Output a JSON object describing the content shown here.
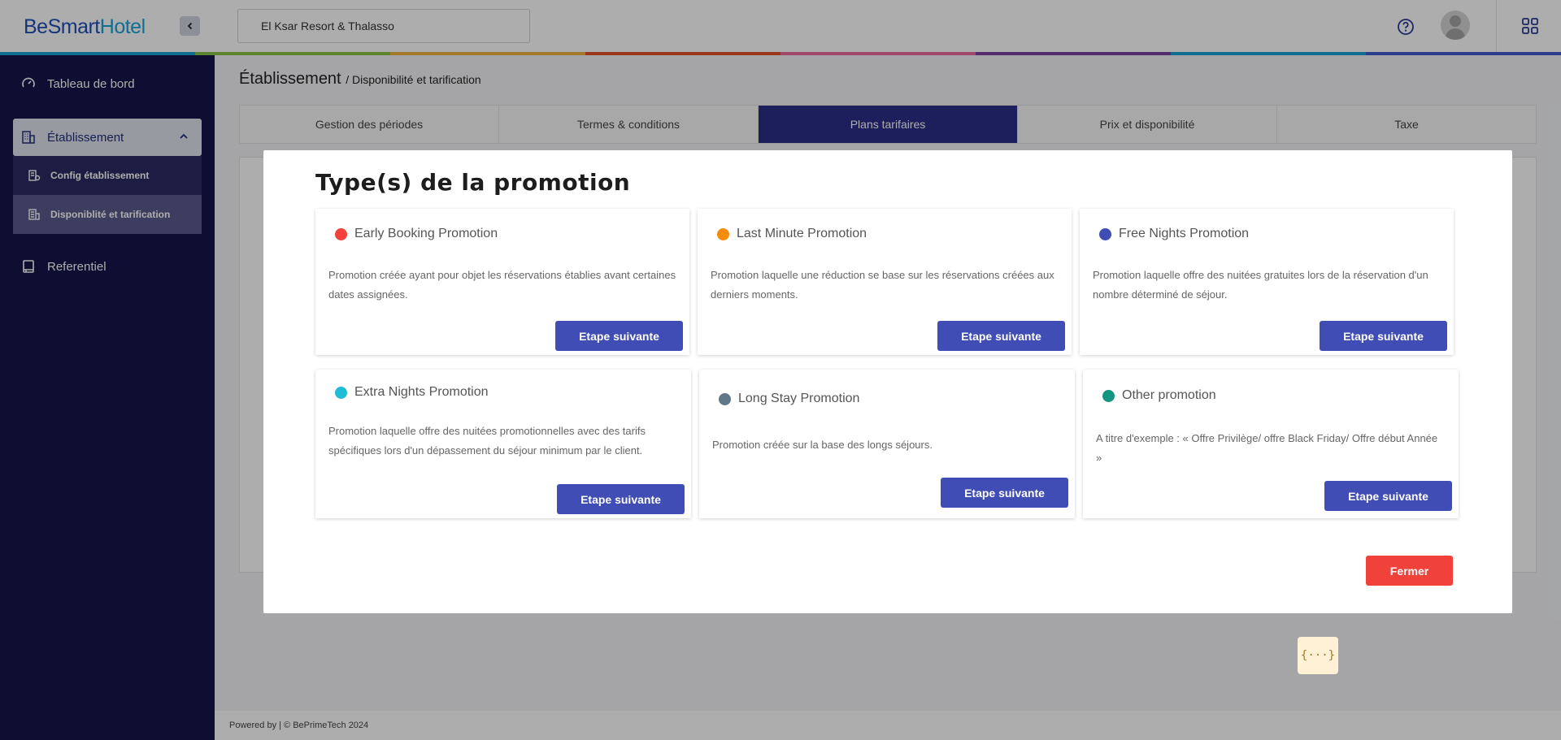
{
  "app": {
    "logo_part1": "BeSmart",
    "logo_part2": "Hotel"
  },
  "header": {
    "hotel_select_value": "El Ksar Resort & Thalasso",
    "rainbow_colors": [
      "#1aa3d6",
      "#8bc34a",
      "#f2b33d",
      "#e2502a",
      "#ec6a9c",
      "#7b3fa0",
      "#1aa3d6",
      "#3f5bd0"
    ]
  },
  "sidebar": {
    "items": [
      {
        "label": "Tableau de bord",
        "icon": "dashboard-icon"
      },
      {
        "label": "Établissement",
        "icon": "building-icon",
        "expanded": true
      },
      {
        "label": "Referentiel",
        "icon": "book-icon"
      }
    ],
    "subitems": [
      {
        "label": "Config établissement",
        "icon": "config-icon"
      },
      {
        "label": "Disponiblité et tarification",
        "icon": "pricing-icon",
        "selected": true
      }
    ]
  },
  "page": {
    "title": "Établissement",
    "breadcrumb": "/ Disponibilité et tarification",
    "tabs": [
      "Gestion des périodes",
      "Termes & conditions",
      "Plans tarifaires",
      "Prix et disponibilité",
      "Taxe"
    ],
    "active_tab": "Plans tarifaires"
  },
  "modal": {
    "title": "Type(s) de la promotion",
    "next_label": "Etape suivante",
    "close_label": "Fermer",
    "cards": [
      {
        "title": "Early Booking Promotion",
        "color": "#f0413a",
        "desc": "Promotion créée ayant pour objet les réservations établies avant certaines dates assignées."
      },
      {
        "title": "Last Minute Promotion",
        "color": "#f58c0c",
        "desc": "Promotion laquelle une réduction se base sur les réservations créées aux derniers moments."
      },
      {
        "title": "Free Nights Promotion",
        "color": "#3f4db4",
        "desc": "Promotion laquelle offre des nuitées gratuites lors de la réservation d'un nombre déterminé de séjour."
      },
      {
        "title": "Extra Nights Promotion",
        "color": "#1fbcd8",
        "desc": "Promotion laquelle offre des nuitées promotionnelles avec des tarifs spécifiques lors d'un dépassement du séjour minimum par le client."
      },
      {
        "title": "Long Stay Promotion",
        "color": "#5f7786",
        "desc": "Promotion créée sur la base des longs séjours."
      },
      {
        "title": "Other promotion",
        "color": "#149582",
        "desc": "A titre d'exemple : « Offre Privilège/ offre Black Friday/ Offre début Année »"
      }
    ]
  },
  "footer": {
    "text": "Powered by | © BePrimeTech 2024"
  },
  "help_widget": {
    "label": "{···}"
  }
}
